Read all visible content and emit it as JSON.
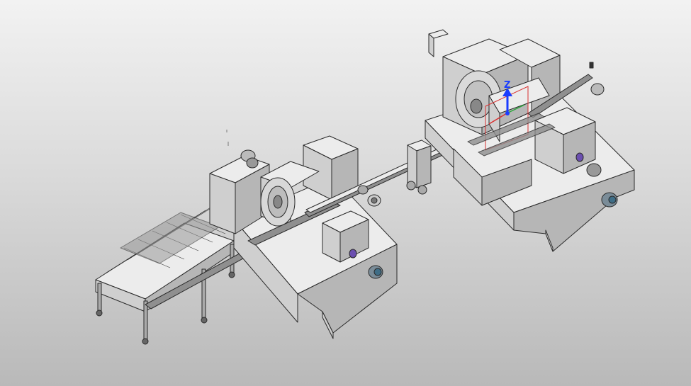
{
  "viewport": {
    "background_top": "#f2f2f2",
    "background_bottom": "#b9b9b9"
  },
  "triad": {
    "z_label": "Z",
    "z_color": "#1a3dff",
    "x_color": "#d93030",
    "y_color": "#2aa83a"
  },
  "icons": [
    "triad-z-arrow-icon",
    "motor-icon"
  ]
}
